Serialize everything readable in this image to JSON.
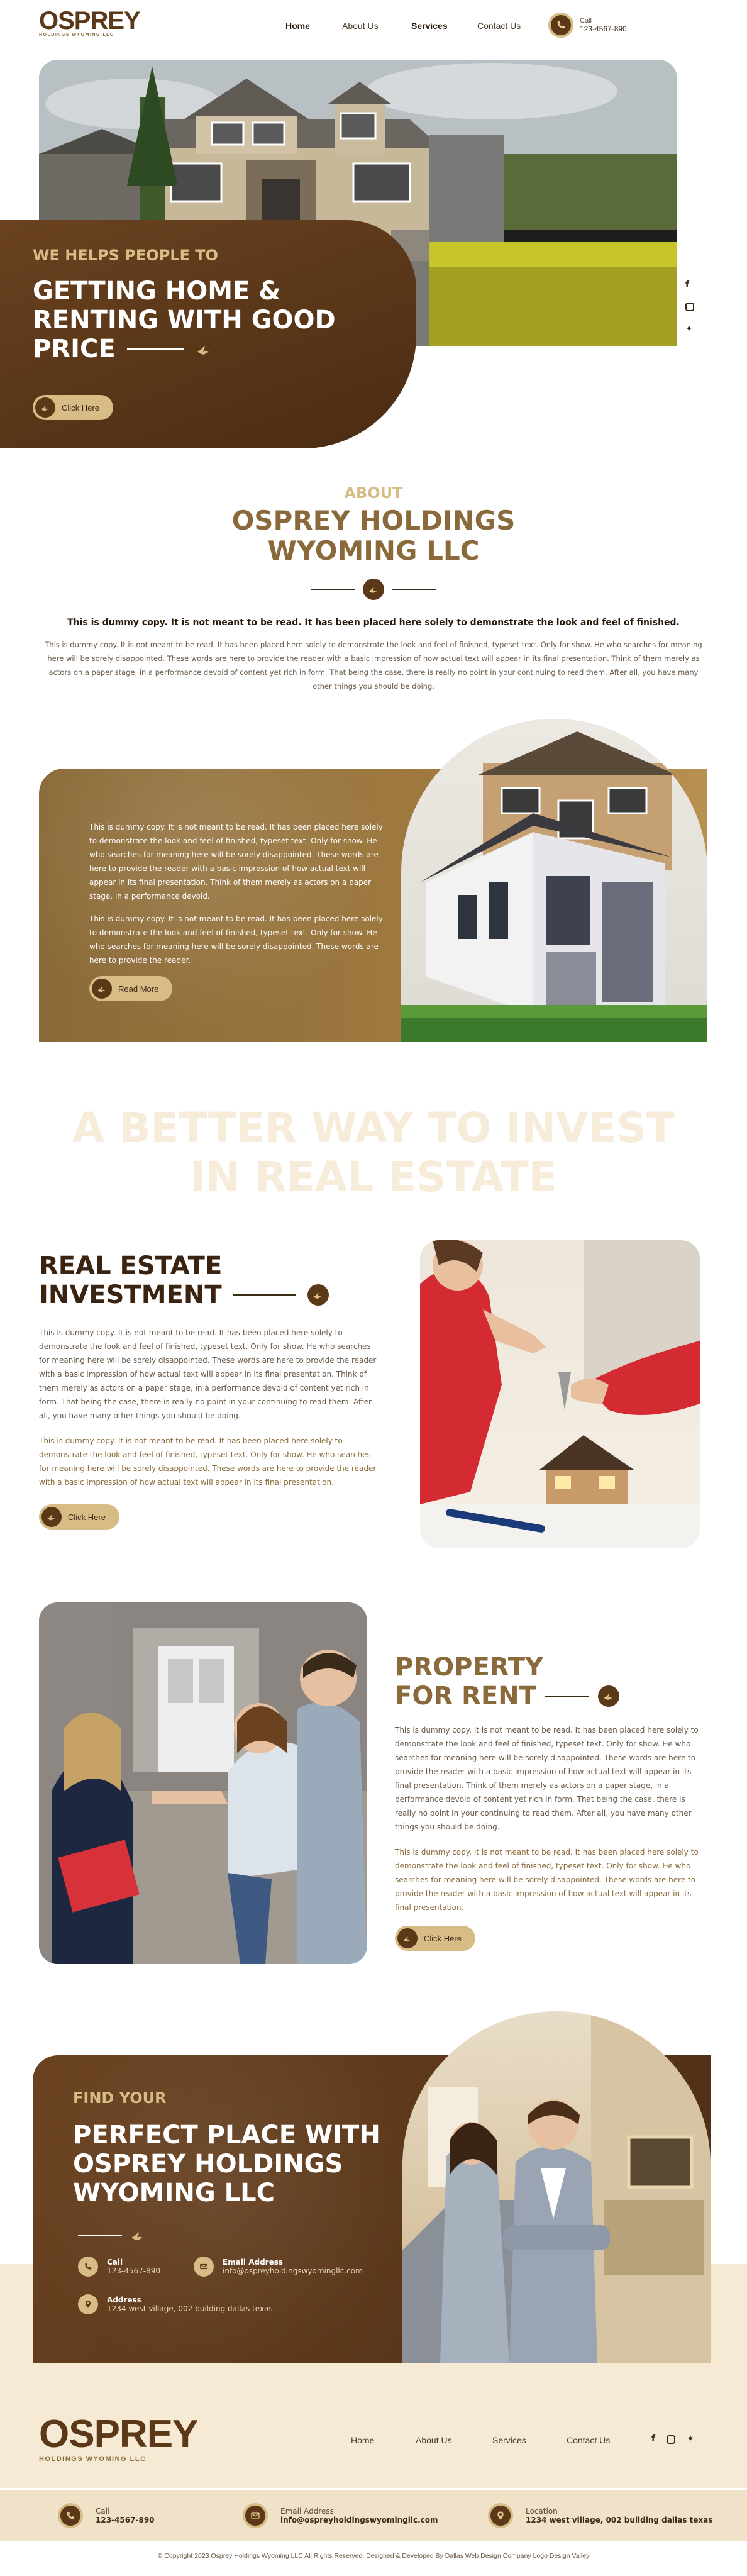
{
  "header": {
    "logo_word": "OSPREY",
    "logo_sub": "HOLDINGS WYOMING LLC",
    "nav": [
      "Home",
      "About Us",
      "Services",
      "Contact Us"
    ],
    "call_label": "Call",
    "call_number": "123-4567-890"
  },
  "hero": {
    "eyebrow": "WE HELPS PEOPLE TO",
    "title_line1": "GETTING HOME &",
    "title_line2": "RENTING WITH GOOD",
    "title_line3": "PRICE",
    "button": "Click Here",
    "social": [
      "facebook-icon",
      "instagram-icon",
      "twitter-icon"
    ]
  },
  "about": {
    "eyebrow": "ABOUT",
    "title_line1": "OSPREY HOLDINGS",
    "title_line2": "WYOMING LLC",
    "lead": "This is dummy copy. It is not meant to be read. It has been placed here solely to demonstrate the look and feel of finished.",
    "para": "This is dummy copy. It is not meant to be read. It has been placed here solely to demonstrate the look and feel of finished, typeset text. Only for show. He who searches for meaning here will be sorely disappointed. These words are here to provide the reader with a basic impression of how actual text will appear in its final presentation. Think of them merely as actors on a paper stage, in a performance devoid of content yet rich in form. That being the case, there is really no point in your continuing to read them. After all, you have many other things you should be doing."
  },
  "feature": {
    "para1": "This is dummy copy. It is not meant to be read. It has been placed here solely to demonstrate the look and feel of finished, typeset text. Only for show. He who searches for meaning here will be sorely disappointed. These words are here to provide the reader with a basic impression of how actual text will appear in its final presentation. Think of them merely as actors on a paper stage, in a performance devoid.",
    "para2": "This is dummy copy. It is not meant to be read. It has been placed here solely to demonstrate the look and feel of finished, typeset text. Only for show. He who searches for meaning here will be sorely disappointed. These words are here to provide the reader.",
    "button": "Read More"
  },
  "watermark": {
    "line1": "A BETTER WAY TO INVEST",
    "line2": "IN REAL ESTATE"
  },
  "investment": {
    "title_line1": "REAL ESTATE",
    "title_line2": "INVESTMENT",
    "para1": "This is dummy copy. It is not meant to be read. It has been placed here solely to demonstrate the look and feel of finished, typeset text. Only for show. He who searches for meaning here will be sorely disappointed. These words are here to provide the reader with a basic impression of how actual text will appear in its final presentation. Think of them merely as actors on a paper stage, in a performance devoid of content yet rich in form. That being the case, there is really no point in your continuing to read them. After all, you have many other things you should be doing.",
    "para2": "This is dummy copy. It is not meant to be read. It has been placed here solely to demonstrate the look and feel of finished, typeset text. Only for show. He who searches for meaning here will be sorely disappointed. These words are here to provide the reader with a basic impression of how actual text will appear in its final presentation.",
    "button": "Click Here"
  },
  "rent": {
    "title_line1": "PROPERTY",
    "title_line2": "FOR RENT",
    "para1": "This is dummy copy. It is not meant to be read. It has been placed here solely to demonstrate the look and feel of finished, typeset text. Only for show. He who searches for meaning here will be sorely disappointed. These words are here to provide the reader with a basic impression of how actual text will appear in its final presentation. Think of them merely as actors on a paper stage, in a performance devoid of content yet rich in form. That being the case, there is really no point in your continuing to read them. After all, you have many other things you should be doing.",
    "para2": "This is dummy copy. It is not meant to be read. It has been placed here solely to demonstrate the look and feel of finished, typeset text. Only for show. He who searches for meaning here will be sorely disappointed. These words are here to provide the reader with a basic impression of how actual text will appear in its final presentation.",
    "button": "Click Here"
  },
  "find": {
    "eyebrow": "FIND YOUR",
    "title_line1": "PERFECT PLACE WITH",
    "title_line2": "OSPREY HOLDINGS",
    "title_line3": "WYOMING LLC",
    "call_label": "Call",
    "call_value": "123-4567-890",
    "email_label": "Email Address",
    "email_value": "info@ospreyholdingswyomingllc.com",
    "address_label": "Address",
    "address_value": "1234 west village, 002 building dallas texas"
  },
  "footer": {
    "logo_word": "OSPREY",
    "logo_sub": "HOLDINGS WYOMING LLC",
    "nav": [
      "Home",
      "About Us",
      "Services",
      "Contact Us"
    ],
    "call_label": "Call",
    "call_value": "123-4567-890",
    "email_label": "Email Address",
    "email_value": "info@ospreyholdingswyomingllc.com",
    "location_label": "Location",
    "location_value": "1234 west village, 002 building dallas texas",
    "copyright": "© Copyright 2023 Osprey Holdings Wyoming LLC All Rights Reserved. Designed & Developed By Dallas Web Design Company Logo Design Valley"
  },
  "colors": {
    "brown_dark": "#4a2c12",
    "brown": "#6a4220",
    "gold": "#8a6a3a",
    "tan": "#d8bc86",
    "cream": "#f6ead5"
  }
}
